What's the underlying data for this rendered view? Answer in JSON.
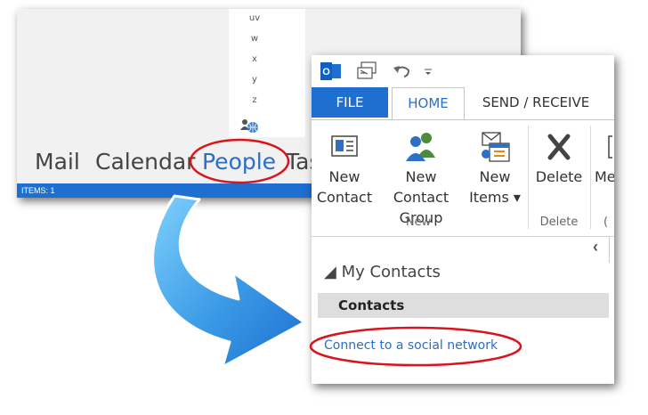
{
  "background_window": {
    "letters": [
      "uv",
      "w",
      "x",
      "y",
      "z"
    ],
    "nav": [
      {
        "label": "Mail"
      },
      {
        "label": "Calendar"
      },
      {
        "label": "People",
        "active": true
      },
      {
        "label": "Tas"
      }
    ],
    "status": "ITEMS: 1"
  },
  "front_window": {
    "qat": {
      "outlook_icon_letter": "O",
      "icons": [
        "outlook-icon",
        "send-receive-icon",
        "undo-icon",
        "qat-dropdown-icon"
      ]
    },
    "tabs": [
      {
        "label": "FILE"
      },
      {
        "label": "HOME"
      },
      {
        "label": "SEND / RECEIVE"
      }
    ],
    "ribbon": {
      "new_contact": {
        "line1": "New",
        "line2": "Contact"
      },
      "new_contact_group": {
        "line1": "New Contact",
        "line2": "Group"
      },
      "new_items": {
        "line1": "New",
        "line2": "Items ▾"
      },
      "group_new_label": "New",
      "delete": {
        "label": "Delete"
      },
      "group_delete_label": "Delete",
      "partial_button": "Me",
      "partial_group": "("
    },
    "collapse_glyph": "‹",
    "my_contacts": "◢ My Contacts",
    "contacts_folder": "Contacts",
    "connect_link": "Connect to a social network"
  },
  "colors": {
    "accent": "#1e6fcf",
    "link": "#2b6ec6",
    "highlight_red": "#d8141c",
    "arrow_blue": "#3a9ae6"
  }
}
